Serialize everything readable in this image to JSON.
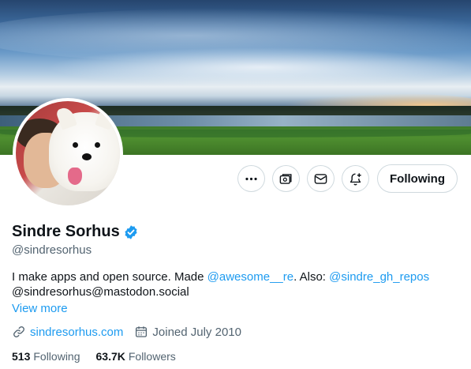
{
  "profile": {
    "name": "Sindre Sorhus",
    "handle": "@sindresorhus",
    "bio": {
      "part1": "I make apps and open source. Made ",
      "mention1": "@awesome__re",
      "part2": ". Also: ",
      "mention2": "@sindre_gh_repos",
      "line2": "@sindresorhus@mastodon.social"
    },
    "view_more": "View more",
    "website": "sindresorhus.com",
    "joined": "Joined July 2010",
    "following_count": "513",
    "following_label": "Following",
    "followers_count": "63.7K",
    "followers_label": "Followers"
  },
  "actions": {
    "following_button": "Following"
  },
  "icons": {
    "more": "more-icon",
    "subscribe": "subscriptions-icon",
    "message": "mail-icon",
    "notify": "bell-add-icon",
    "verified": "verified-badge-icon",
    "link": "link-icon",
    "calendar": "calendar-icon"
  },
  "colors": {
    "accent": "#1d9bf0",
    "text": "#0f1419",
    "secondary": "#536471",
    "border": "#cfd9de"
  }
}
